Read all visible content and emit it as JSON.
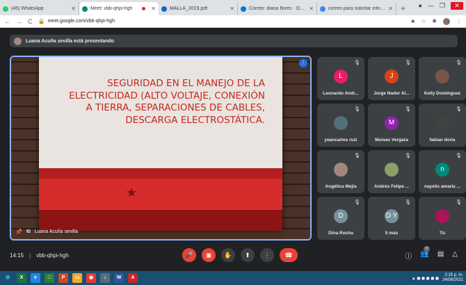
{
  "browser": {
    "tabs": [
      {
        "title": "(45) WhatsApp",
        "color": "#25d366"
      },
      {
        "title": "Meet: vbb-qhpi-hgh",
        "color": "#00897b",
        "active": true
      },
      {
        "title": "MALLA_2019.pdf",
        "color": "#1565c0"
      },
      {
        "title": "Correo: diana flores - Outlook",
        "color": "#0078d4"
      },
      {
        "title": "correo para solicitar informaci",
        "color": "#4285f4"
      }
    ],
    "new_tab": "+",
    "url": "meet.google.com/vbb-qhpi-hgh"
  },
  "presenting_banner": "Luana Acuña sevilla está presentando",
  "slide": {
    "title": "SEGURIDAD EN EL MANEJO DE LA ELECTRICIDAD (ALTO VOLTAJE, CONEXIÓN A TIERRA, SEPARACIONES DE CABLES, DESCARGA ELECTROSTÁTICA."
  },
  "presenter_name": "Luana Acuña sevilla",
  "participants": [
    {
      "name": "Leonardo Andr...",
      "initial": "L",
      "color": "#e91e63"
    },
    {
      "name": "Jorge Nader Al...",
      "initial": "J",
      "color": "#d84315"
    },
    {
      "name": "Kelly Dominguez",
      "initial": "",
      "color": "#795548"
    },
    {
      "name": "yeancarlos ruiz",
      "initial": "",
      "color": "#546e7a"
    },
    {
      "name": "Moises Vergara",
      "initial": "M",
      "color": "#8e24aa"
    },
    {
      "name": "fabian doria",
      "initial": "",
      "color": "#424242"
    },
    {
      "name": "Angélica Mejía",
      "initial": "",
      "color": "#a1887f"
    },
    {
      "name": "Andrés Felipe ...",
      "initial": "",
      "color": "#8d9e6b"
    },
    {
      "name": "nayelis amaris ...",
      "initial": "n",
      "color": "#00897b"
    },
    {
      "name": "Dina Rocha",
      "initial": "D",
      "color": "#78909c"
    },
    {
      "name": "5 más",
      "initial": "D Y",
      "color": "#78909c"
    },
    {
      "name": "Tú",
      "initial": "",
      "color": "#ad1457"
    }
  ],
  "meeting": {
    "time": "14:15",
    "code": "vbb-qhpi-hgh",
    "participant_count": "17"
  },
  "taskbar": {
    "time": "2:15 p. m.",
    "date": "24/08/2021"
  }
}
